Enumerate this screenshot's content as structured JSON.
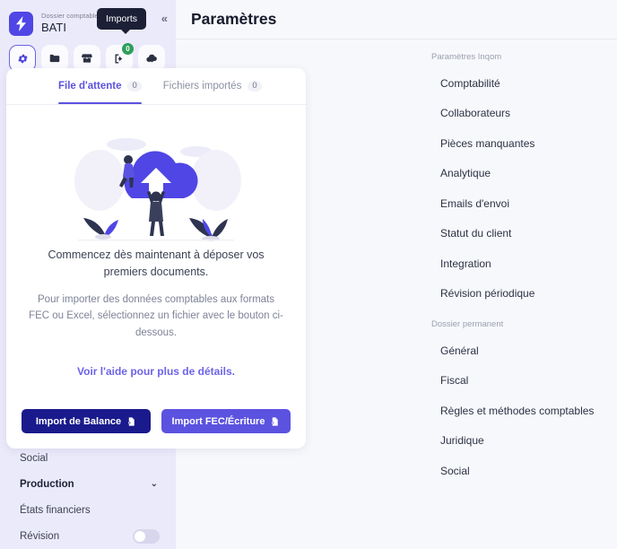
{
  "colors": {
    "accent": "#5b52e0",
    "accent_dark": "#1a1a8c",
    "sidebar_bg": "#ebeafa",
    "page_bg": "#f7f8fb",
    "badge_green": "#2f9e5a",
    "tooltip_bg": "#1b2036"
  },
  "sidebar": {
    "subtitle": "Dossier comptable",
    "folder_name": "BATI",
    "collapse_label": "«",
    "tooltip": "Imports",
    "icons": [
      {
        "name": "gear-icon",
        "active": true,
        "badge": null
      },
      {
        "name": "folder-icon",
        "active": false,
        "badge": null
      },
      {
        "name": "store-icon",
        "active": false,
        "badge": null
      },
      {
        "name": "imports-icon",
        "active": false,
        "badge": "0"
      },
      {
        "name": "cloud-download-icon",
        "active": false,
        "badge": null
      }
    ],
    "items": [
      {
        "label": "Social",
        "type": "link"
      },
      {
        "label": "Production",
        "type": "group",
        "chevron": "⌄"
      },
      {
        "label": "États financiers",
        "type": "link"
      },
      {
        "label": "Révision",
        "type": "toggle",
        "toggle_on": false
      }
    ]
  },
  "header": {
    "title": "Paramètres"
  },
  "settings_panel": {
    "sections": [
      {
        "title": "Paramètres Inqom",
        "items": [
          "Comptabilité",
          "Collaborateurs",
          "Pièces manquantes",
          "Analytique",
          "Emails d'envoi",
          "Statut du client",
          "Integration",
          "Révision périodique"
        ]
      },
      {
        "title": "Dossier permanent",
        "items": [
          "Général",
          "Fiscal",
          "Règles et méthodes comptables",
          "Juridique",
          "Social"
        ]
      }
    ]
  },
  "imports_card": {
    "tabs": [
      {
        "label": "File d'attente",
        "count": "0",
        "active": true
      },
      {
        "label": "Fichiers importés",
        "count": "0",
        "active": false
      }
    ],
    "illustration": "cloud-upload-illustration",
    "lead_text": "Commencez dès maintenant à déposer vos premiers documents.",
    "sub_text": "Pour importer des données comptables aux formats FEC ou Excel, sélectionnez un fichier avec le bouton ci-dessous.",
    "help_link": "Voir l'aide pour plus de détails.",
    "buttons": [
      {
        "label": "Import de Balance",
        "style": "dark",
        "icon": "file-import-icon"
      },
      {
        "label": "Import FEC/Écriture",
        "style": "purple",
        "icon": "file-import-icon"
      }
    ]
  }
}
